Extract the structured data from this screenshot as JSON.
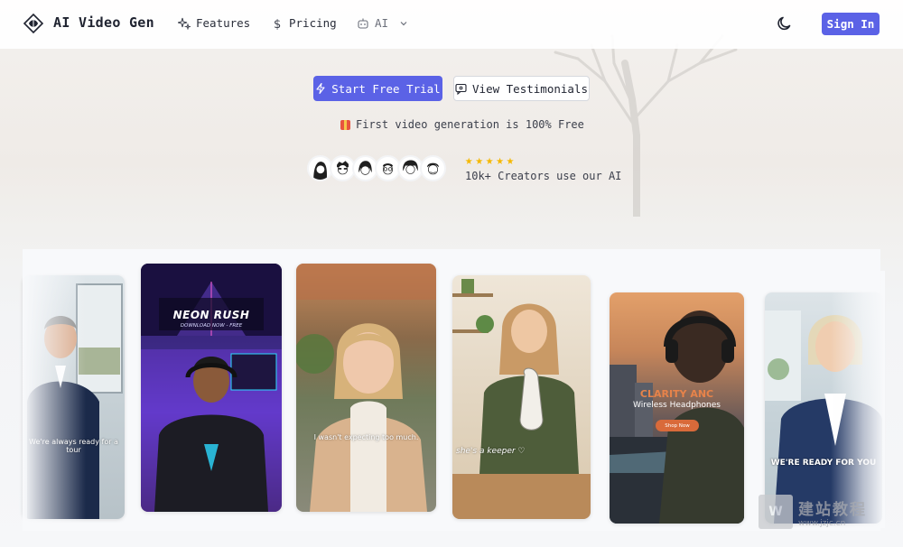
{
  "nav": {
    "brand": "AI Video Gen",
    "links": [
      {
        "label": "Features",
        "icon": "sparkles-icon"
      },
      {
        "label": "Pricing",
        "icon": "dollar-icon"
      },
      {
        "label": "AI",
        "icon": "robot-icon"
      }
    ],
    "sign_in": "Sign In"
  },
  "hero": {
    "primary_cta": "Start Free Trial",
    "secondary_cta": "View Testimonials",
    "free_note": "First video generation is 100% Free",
    "rating_stars": 5,
    "creators_text": "10k+ Creators use our AI"
  },
  "gallery": {
    "cards": [
      {
        "caption": "We're always ready for a tour"
      },
      {
        "title": "NEON RUSH",
        "subtitle": "DOWNLOAD NOW - FREE"
      },
      {
        "caption": "I wasn't expecting too much."
      },
      {
        "caption": "she's a keeper ♡"
      },
      {
        "brand": "CLARITY ANC",
        "product": "Wireless Headphones",
        "cta": "Shop Now"
      },
      {
        "caption": "WE'RE READY FOR YOU"
      }
    ]
  },
  "watermark": {
    "cn": "建站教程",
    "url": "www.jzjc.cn"
  },
  "colors": {
    "accent": "#5b62e6",
    "star": "#f5b800"
  }
}
